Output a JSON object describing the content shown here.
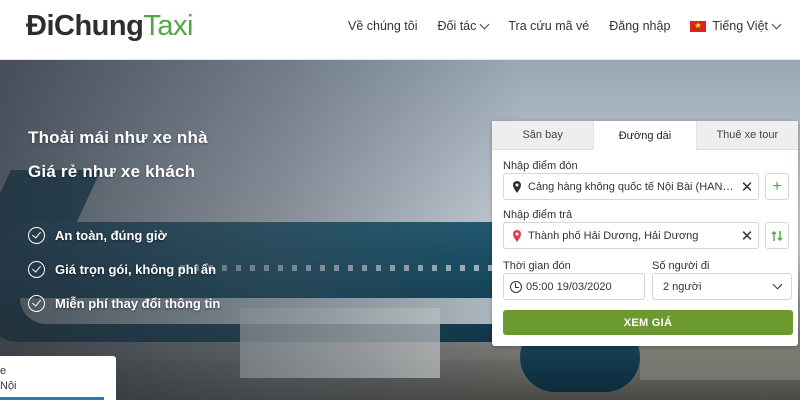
{
  "logo": {
    "part1": "Đi",
    "part2": "Chung",
    "part3": "Taxi"
  },
  "nav": {
    "about": "Về chúng tôi",
    "partners": "Đối tác",
    "lookup": "Tra cứu mã vé",
    "login": "Đăng nhập",
    "language": "Tiếng Việt"
  },
  "hero": {
    "tagline1": "Thoải mái như xe nhà",
    "tagline2": "Giá rẻ như xe khách",
    "features": [
      "An toàn, đúng giờ",
      "Giá trọn gói, không phí ẩn",
      "Miễn phí thay đổi thông tin"
    ],
    "mini_card_line1": "e",
    "mini_card_line2": "Nội"
  },
  "booking": {
    "tabs": [
      "Sân bay",
      "Đường dài",
      "Thuê xe tour"
    ],
    "active_tab": 1,
    "pickup_label": "Nhập điểm đón",
    "pickup_value": "Cảng hàng không quốc tế Nội Bài (HAN), Sóc Sơn, Hà Nội",
    "dropoff_label": "Nhập điểm trả",
    "dropoff_value": "Thành phố Hải Dương, Hải Dương",
    "time_label": "Thời gian đón",
    "time_value": "05:00 19/03/2020",
    "passengers_label": "Số người đi",
    "passengers_value": "2 người",
    "submit_label": "XEM GIÁ"
  },
  "colors": {
    "brand_green": "#4ea83e",
    "submit_green": "#6a9a2f",
    "pin_red": "#e23b4a"
  }
}
